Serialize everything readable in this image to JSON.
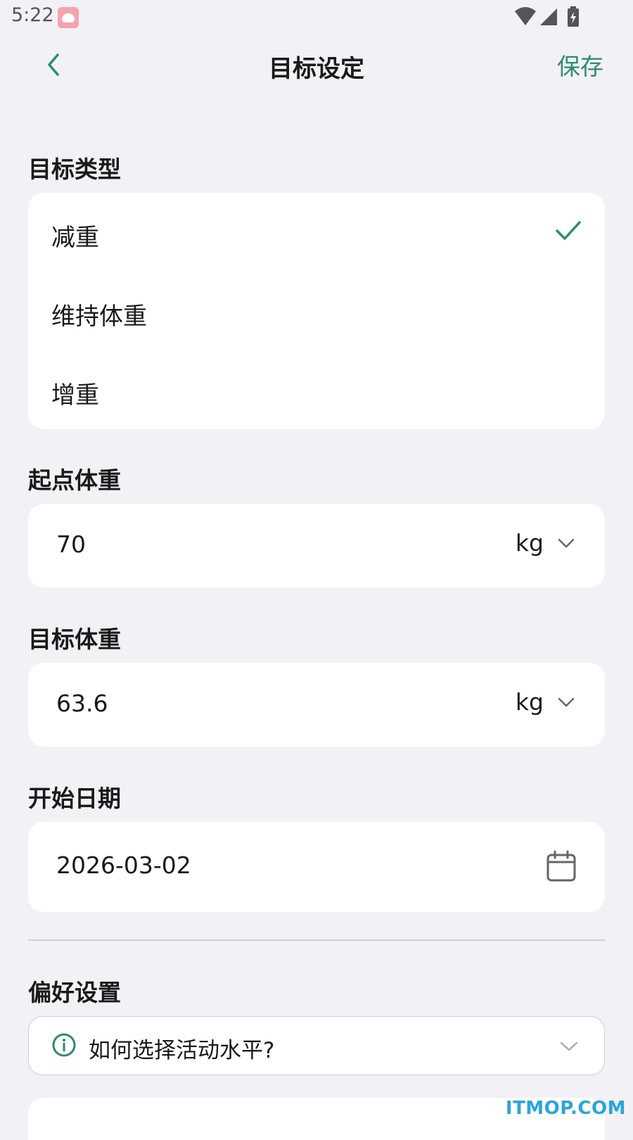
{
  "status_bar": {
    "time": "5:22"
  },
  "header": {
    "title": "目标设定",
    "save_label": "保存"
  },
  "goal_type": {
    "label": "目标类型",
    "options": [
      {
        "label": "减重",
        "selected": true
      },
      {
        "label": "维持体重",
        "selected": false
      },
      {
        "label": "增重",
        "selected": false
      }
    ]
  },
  "start_weight": {
    "label": "起点体重",
    "value": "70",
    "unit": "kg"
  },
  "target_weight": {
    "label": "目标体重",
    "value": "63.6",
    "unit": "kg"
  },
  "start_date": {
    "label": "开始日期",
    "value": "2026-03-02"
  },
  "preferences": {
    "label": "偏好设置",
    "info_text": "如何选择活动水平?"
  },
  "watermark": "ITMOP.COM",
  "colors": {
    "accent": "#2e8b6b",
    "background": "#f1f1f6",
    "card": "#ffffff"
  },
  "icons": [
    "back-chevron-icon",
    "check-icon",
    "chevron-down-icon",
    "calendar-icon",
    "info-icon",
    "wifi-icon",
    "signal-icon",
    "battery-icon"
  ]
}
